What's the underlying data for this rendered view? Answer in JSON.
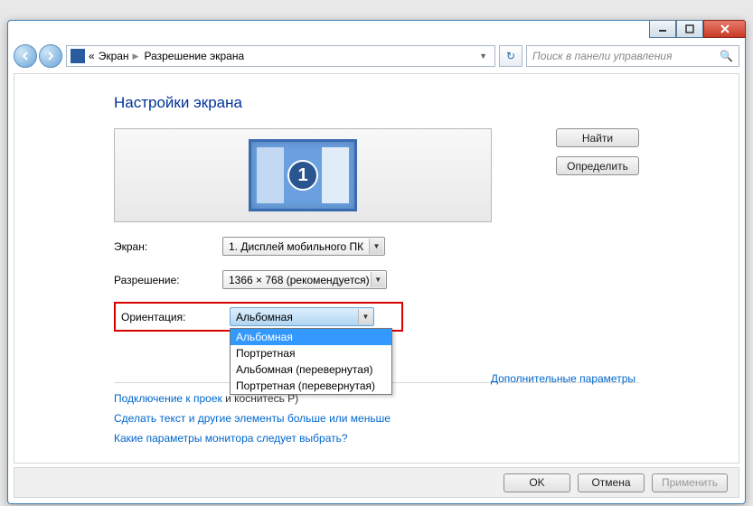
{
  "breadcrumbs": {
    "prefix": "«",
    "item1": "Экран",
    "item2": "Разрешение экрана"
  },
  "search": {
    "placeholder": "Поиск в панели управления"
  },
  "title": "Настройки экрана",
  "monitor_number": "1",
  "buttons": {
    "find": "Найти",
    "detect": "Определить",
    "ok": "OK",
    "cancel": "Отмена",
    "apply": "Применить"
  },
  "labels": {
    "screen": "Экран:",
    "resolution": "Разрешение:",
    "orientation": "Ориентация:"
  },
  "values": {
    "screen": "1. Дисплей мобильного ПК",
    "resolution": "1366 × 768 (рекомендуется)",
    "orientation": "Альбомная"
  },
  "orientation_options": [
    "Альбомная",
    "Портретная",
    "Альбомная (перевернутая)",
    "Портретная (перевернутая)"
  ],
  "orientation_selected_index": 0,
  "links": {
    "advanced": "Дополнительные параметры",
    "projector_head": "Подключение к проек",
    "projector_tail": "и коснитесь P)",
    "text_size": "Сделать текст и другие элементы больше или меньше",
    "which_monitor": "Какие параметры монитора следует выбрать?"
  }
}
